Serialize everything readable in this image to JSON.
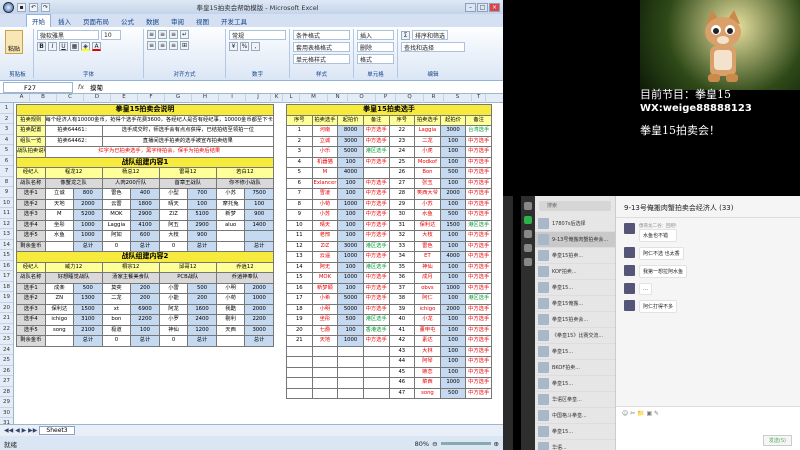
{
  "excel": {
    "title": "拳皇15拍卖会帮助模版 - Microsoft Excel",
    "tabs": [
      "开始",
      "插入",
      "页面布局",
      "公式",
      "数据",
      "审阅",
      "视图",
      "开发工具"
    ],
    "ribbon": {
      "paste": "粘贴",
      "clipboard": "剪贴板",
      "font_name": "微软雅黑",
      "font_size": "10",
      "font_group": "字体",
      "align_group": "对齐方式",
      "num_format": "常规",
      "num_group": "数字",
      "cond_fmt": "条件格式",
      "table_fmt": "套用表格格式",
      "cell_style": "单元格样式",
      "style_group": "样式",
      "insert": "插入",
      "delete": "删除",
      "format": "格式",
      "cell_group": "单元格",
      "sum": "Σ",
      "sort": "排序和筛选",
      "find": "查找和选择",
      "edit_group": "编辑"
    },
    "name_box": "F27",
    "fx": "fx",
    "formula": "摸葡",
    "columns": [
      "A",
      "B",
      "C",
      "D",
      "E",
      "F",
      "G",
      "H",
      "I",
      "J",
      "K",
      "L",
      "M",
      "N",
      "O",
      "P",
      "Q",
      "R",
      "S",
      "T"
    ],
    "rows": [
      "1",
      "2",
      "3",
      "4",
      "5",
      "6",
      "7",
      "8",
      "9",
      "10",
      "11",
      "12",
      "13",
      "14",
      "15",
      "16",
      "17",
      "18",
      "19",
      "20",
      "21",
      "22",
      "23",
      "24",
      "25",
      "26",
      "27",
      "28",
      "29",
      "30",
      "31"
    ],
    "left": {
      "title": "拳皇15拍卖会说明",
      "rules": [
        {
          "k": "拍卖规则",
          "v": "每个经济人有10000金币，抢得个选手花费3600，各经纪人是否有经纪事，10000金币都至下卡8名选"
        },
        {
          "k": "拍卖配置",
          "v": "拍卖64461：",
          "v2": "选手成交时，师选手会有点点获得，已结拍结至领拍一位"
        },
        {
          "k": "组队一览",
          "v": "拍卖64462：",
          "v2": "直播间选手拍卖的选手被宣布拍卖结果"
        },
        {
          "k": "战队拍卖说明",
          "v": "红字为已拍卖选手，黑字待拍会，保手为拍卖后结果"
        }
      ],
      "team1_title": "战队组建内容1",
      "team2_title": "战队组建内容2",
      "t1_heads": [
        "经纪人",
        "程龙12",
        "杨总12",
        "雷哥12",
        "若白12"
      ],
      "t1_sub": [
        "战队名称",
        "像蟹龙之队",
        "人肉200斤队",
        "首章王战队",
        "你不修小战队"
      ],
      "t1_rows": [
        [
          "选手1",
          "立诚",
          "800",
          "雷色",
          "400",
          "小型",
          "700",
          "小苏",
          "7500"
        ],
        [
          "选手2",
          "天地",
          "2000",
          "云雷",
          "1800",
          "晴天",
          "100",
          "摩托兔",
          "100"
        ],
        [
          "选手3",
          "M",
          "5200",
          "MOK",
          "2900",
          "ZiZ",
          "5100",
          "新梦",
          "900"
        ],
        [
          "选手4",
          "坐彤",
          "1000",
          "Laggia",
          "4100",
          "阿五",
          "2900",
          "aluo",
          "1400"
        ],
        [
          "选手5",
          "水鱼",
          "1000",
          "阿如",
          "600",
          "大枝",
          "900",
          "",
          ""
        ],
        [
          "剩余金币",
          "",
          "总计",
          "0",
          "总计",
          "0",
          "总计",
          "",
          "总计"
        ]
      ],
      "t2_heads": [
        "经纪人",
        "威力12",
        "桐宗12",
        "邱哥12",
        "乔逍12"
      ],
      "t2_sub": [
        "战队名称",
        "好想睡觉战队",
        "汤家主餐美食队",
        "PCB战队",
        "乔逍神奉队"
      ],
      "t2_rows": [
        [
          "选手1",
          "成楽",
          "500",
          "莫奕",
          "200",
          "小雷",
          "500",
          "小明",
          "2000"
        ],
        [
          "选手2",
          "ZN",
          "1300",
          "二龙",
          "200",
          "小能",
          "200",
          "小苟",
          "1000"
        ],
        [
          "选手3",
          "保利达",
          "1500",
          "xt",
          "6900",
          "阿龙",
          "1600",
          "我酷",
          "2000"
        ],
        [
          "选手4",
          "ichigo",
          "3100",
          "bon",
          "2200",
          "小罗",
          "2400",
          "剔利",
          "2200"
        ],
        [
          "选手5",
          "song",
          "2100",
          "极道",
          "100",
          "神仙",
          "1200",
          "天西",
          "3000"
        ],
        [
          "剩余金币",
          "",
          "总计",
          "0",
          "总计",
          "0",
          "总计",
          "",
          "总计"
        ]
      ]
    },
    "right": {
      "title": "拳皇15拍卖选手",
      "heads": [
        "序号",
        "拍卖选手",
        "起拍价",
        "备注",
        "序号",
        "拍卖选手",
        "起拍价",
        "备注"
      ],
      "rows": [
        [
          "1",
          "河南",
          "8000",
          "中方选手",
          "22",
          "Laggia",
          "3000",
          "台湾选手"
        ],
        [
          "2",
          "立诚",
          "3000",
          "中方选手",
          "23",
          "二龙",
          "100",
          "中方选手"
        ],
        [
          "3",
          "小乐",
          "5000",
          "港区选手",
          "24",
          "小虎",
          "100",
          "中方选手"
        ],
        [
          "4",
          "机器猫",
          "100",
          "中方选手",
          "25",
          "Modkof",
          "100",
          "中方选手"
        ],
        [
          "5",
          "M",
          "4000",
          "",
          "26",
          "Bon",
          "500",
          "中方选手"
        ],
        [
          "6",
          "Exlancer",
          "100",
          "中方选手",
          "27",
          "张玉",
          "100",
          "中方选手"
        ],
        [
          "7",
          "雪凌",
          "100",
          "中方选手",
          "28",
          "笑西大爷",
          "2000",
          "中方选手"
        ],
        [
          "8",
          "小苟",
          "1000",
          "中方选手",
          "29",
          "小苏",
          "100",
          "中方选手"
        ],
        [
          "9",
          "小苏",
          "100",
          "中方选手",
          "30",
          "水鱼",
          "500",
          "中方选手"
        ],
        [
          "10",
          "晴天",
          "100",
          "中方选手",
          "31",
          "保利达",
          "1500",
          "港区选手"
        ],
        [
          "11",
          "老邢",
          "100",
          "中方选手",
          "32",
          "大枝",
          "100",
          "中方选手"
        ],
        [
          "12",
          "ZiZ",
          "3000",
          "港区选手",
          "33",
          "雷色",
          "100",
          "中方选手"
        ],
        [
          "13",
          "云遥",
          "1000",
          "中方选手",
          "34",
          "ET",
          "4000",
          "中方选手"
        ],
        [
          "14",
          "阿无",
          "100",
          "港区选手",
          "35",
          "神仙",
          "100",
          "中方选手"
        ],
        [
          "15",
          "MOK",
          "1000",
          "中方选手",
          "36",
          "成月",
          "100",
          "中方选手"
        ],
        [
          "16",
          "新梦颖",
          "100",
          "中方选手",
          "37",
          "obvs",
          "1000",
          "中方选手"
        ],
        [
          "17",
          "小希",
          "5000",
          "中方选手",
          "38",
          "阿仁",
          "100",
          "港区选手"
        ],
        [
          "18",
          "小明",
          "5000",
          "中方选手",
          "39",
          "ichigo",
          "2000",
          "中方选手"
        ],
        [
          "19",
          "坐彤",
          "500",
          "港区选手",
          "40",
          "小龙",
          "100",
          "中方选手"
        ],
        [
          "20",
          "七爵",
          "100",
          "香港选手",
          "41",
          "董申屯",
          "100",
          "中方选手"
        ],
        [
          "21",
          "天地",
          "1000",
          "中方选手",
          "42",
          "素达",
          "100",
          "中方选手"
        ],
        [
          "",
          "",
          "",
          "",
          "43",
          "大林",
          "100",
          "中方选手"
        ],
        [
          "",
          "",
          "",
          "",
          "44",
          "阿琴",
          "100",
          "中方选手"
        ],
        [
          "",
          "",
          "",
          "",
          "45",
          "嫉恋",
          "100",
          "中方选手"
        ],
        [
          "",
          "",
          "",
          "",
          "46",
          "菜西",
          "1000",
          "中方选手"
        ],
        [
          "",
          "",
          "",
          "",
          "47",
          "song",
          "500",
          "中方选手"
        ]
      ],
      "row_order_left": [
        "3",
        "4",
        "5",
        "6",
        "7",
        "8",
        "9",
        "10",
        "11",
        "12",
        "13",
        "14",
        "15",
        "16",
        "17",
        "18",
        "19",
        "20",
        "21",
        "22",
        "23",
        "24",
        "25",
        "26",
        "27",
        "28",
        "29",
        "30",
        "31",
        "32",
        "33",
        "34",
        "35",
        "36",
        "37",
        "38",
        "39",
        "40",
        "41",
        "42",
        "43",
        "44",
        "45",
        "46",
        "47"
      ]
    },
    "sheet_tab": "Sheet3",
    "status": "就绪",
    "zoom": "80%"
  },
  "stream": {
    "program_label": "目前节目：拳皇15",
    "wx": "WX:weige88888123",
    "auction": "拳皇15拍卖会！"
  },
  "chat": {
    "title": "9-13号俺搬肉蟹拍卖会经济人 (33)",
    "search": "搜索",
    "list": [
      "17807s后选择",
      "9-13号俺搬肉蟹拍卖会...",
      "拳皇15拍卖...",
      "KOF拍卖...",
      "拳皇15...",
      "拳皇15俺搬...",
      "拳皇15拍卖会...",
      "《拳皇15》比赛交流...",
      "拳皇15...",
      "BKOF拍卖...",
      "拳皇15...",
      "华语区拳皇...",
      "中国格斗拳皇...",
      "拳皇15...",
      "华语..."
    ],
    "messages": [
      {
        "who": "傻哥龙二谷：回吧!",
        "text": "水鱼也不错"
      },
      {
        "who": "",
        "text": "阿仁不选 也太香"
      },
      {
        "who": "",
        "text": "我第一想拉阿水鱼"
      },
      {
        "who": "",
        "text": ""
      },
      {
        "who": "",
        "text": "阿仁打得不多"
      }
    ],
    "send": "发送(S)",
    "tools": "☺ ✂ 📁 ▣ ✎"
  }
}
